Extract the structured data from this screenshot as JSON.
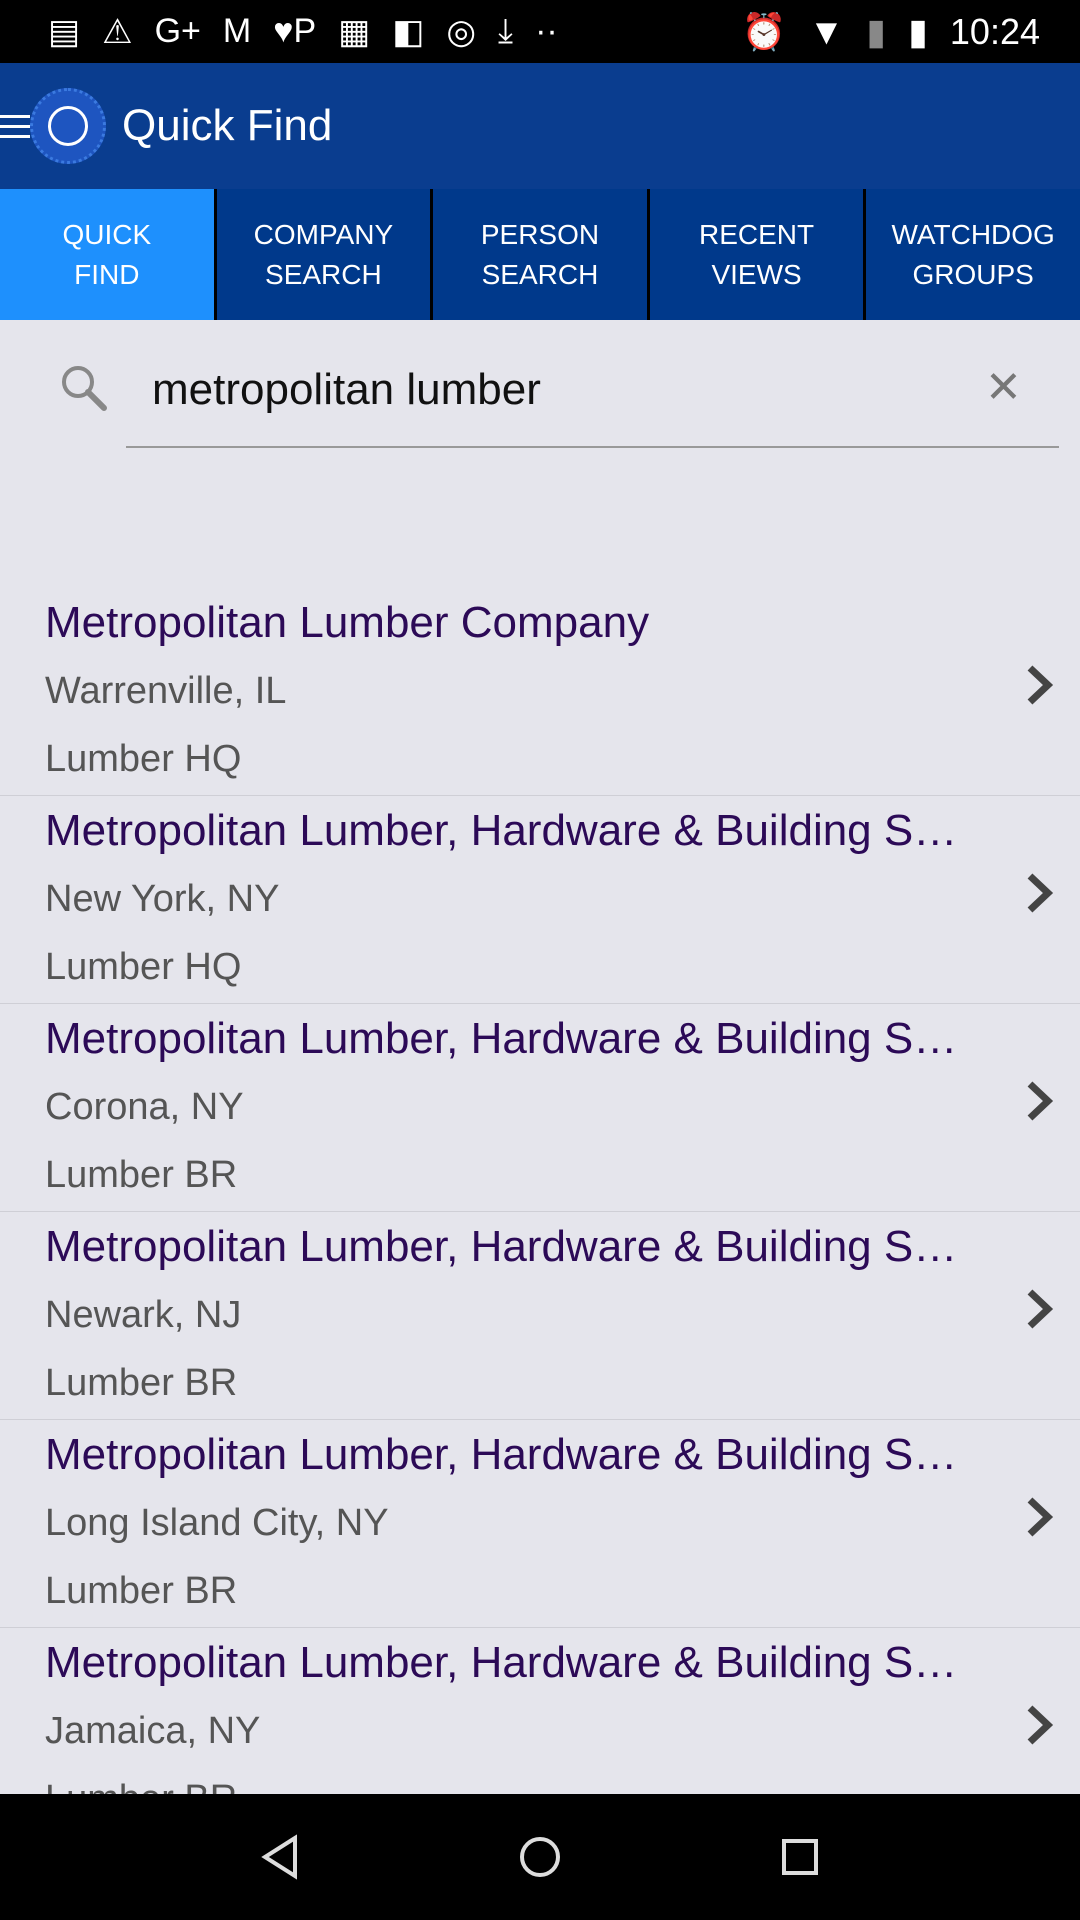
{
  "status_bar": {
    "time": "10:24",
    "icons": [
      "news-icon",
      "warning-icon",
      "google-plus-icon",
      "gmail-icon",
      "heart-p-icon",
      "english-app-icon",
      "media-icon",
      "instagram-icon",
      "download-icon",
      "more-dots-icon"
    ],
    "right_icons": [
      "alarm-icon",
      "wifi-icon",
      "no-sim-icon",
      "battery-charging-icon"
    ]
  },
  "app_bar": {
    "title": "Quick Find"
  },
  "tabs": [
    {
      "line1": "QUICK",
      "line2": "FIND",
      "active": true
    },
    {
      "line1": "COMPANY",
      "line2": "SEARCH"
    },
    {
      "line1": "PERSON",
      "line2": "SEARCH"
    },
    {
      "line1": "RECENT",
      "line2": "VIEWS"
    },
    {
      "line1": "WATCHDOG",
      "line2": "GROUPS"
    }
  ],
  "search": {
    "value": "metropolitan lumber"
  },
  "results": [
    {
      "name": "Metropolitan Lumber Company",
      "location": "Warrenville, IL",
      "type": "Lumber HQ"
    },
    {
      "name": "Metropolitan Lumber, Hardware & Building Supplies",
      "location": "New York, NY",
      "type": "Lumber HQ"
    },
    {
      "name": "Metropolitan Lumber, Hardware & Building Supplies",
      "location": "Corona, NY",
      "type": "Lumber BR"
    },
    {
      "name": "Metropolitan Lumber, Hardware & Building Supplies",
      "location": "Newark, NJ",
      "type": "Lumber BR"
    },
    {
      "name": "Metropolitan Lumber, Hardware & Building Supplies",
      "location": "Long Island City, NY",
      "type": "Lumber BR"
    },
    {
      "name": "Metropolitan Lumber, Hardware & Building Supplies",
      "location": "Jamaica, NY",
      "type": "Lumber BR"
    }
  ],
  "colors": {
    "app_bar": "#0a3d8f",
    "tab": "#00398b",
    "tab_active": "#1e90fd",
    "result_title": "#2c0a57"
  }
}
